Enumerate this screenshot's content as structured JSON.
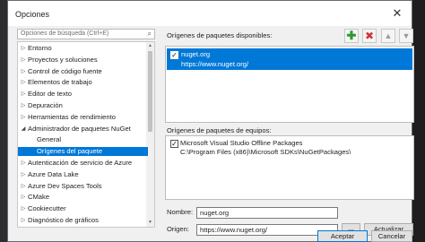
{
  "window": {
    "title": "Opciones",
    "close_glyph": "✕"
  },
  "search": {
    "placeholder": "Opciones de búsqueda (Ctrl+E)",
    "icon": "search-icon"
  },
  "tree": {
    "items": [
      {
        "label": "Entorno",
        "expanded": false,
        "depth": 0,
        "selected": false
      },
      {
        "label": "Proyectos y soluciones",
        "expanded": false,
        "depth": 0,
        "selected": false
      },
      {
        "label": "Control de código fuente",
        "expanded": false,
        "depth": 0,
        "selected": false
      },
      {
        "label": "Elementos de trabajo",
        "expanded": false,
        "depth": 0,
        "selected": false
      },
      {
        "label": "Editor de texto",
        "expanded": false,
        "depth": 0,
        "selected": false
      },
      {
        "label": "Depuración",
        "expanded": false,
        "depth": 0,
        "selected": false
      },
      {
        "label": "Herramientas de rendimiento",
        "expanded": false,
        "depth": 0,
        "selected": false
      },
      {
        "label": "Administrador de paquetes NuGet",
        "expanded": true,
        "depth": 0,
        "selected": false
      },
      {
        "label": "General",
        "expanded": null,
        "depth": 1,
        "selected": false
      },
      {
        "label": "Orígenes del paquete",
        "expanded": null,
        "depth": 1,
        "selected": true
      },
      {
        "label": "Autenticación de servicio de Azure",
        "expanded": false,
        "depth": 0,
        "selected": false
      },
      {
        "label": "Azure Data Lake",
        "expanded": false,
        "depth": 0,
        "selected": false
      },
      {
        "label": "Azure Dev Spaces Tools",
        "expanded": false,
        "depth": 0,
        "selected": false
      },
      {
        "label": "CMake",
        "expanded": false,
        "depth": 0,
        "selected": false
      },
      {
        "label": "Cookiecutter",
        "expanded": false,
        "depth": 0,
        "selected": false
      },
      {
        "label": "Diagnóstico de gráficos",
        "expanded": false,
        "depth": 0,
        "selected": false
      }
    ]
  },
  "available": {
    "label": "Orígenes de paquetes disponibles:",
    "sources": [
      {
        "name": "nuget.org",
        "url": "https://www.nuget.org/",
        "checked": true
      }
    ]
  },
  "toolbar": {
    "add_glyph": "✚",
    "remove_glyph": "✖",
    "up_glyph": "▲",
    "down_glyph": "▼"
  },
  "machine": {
    "label": "Orígenes de paquetes de equipos:",
    "sources": [
      {
        "name": "Microsoft Visual Studio Offline Packages",
        "path": "C:\\Program Files (x86)\\Microsoft SDKs\\NuGetPackages\\",
        "checked": true
      }
    ]
  },
  "form": {
    "name_label": "Nombre:",
    "name_value": "nuget.org",
    "source_label": "Origen:",
    "source_value": "https://www.nuget.org/",
    "browse_label": "...",
    "update_label": "Actualizar"
  },
  "footer": {
    "accept_label": "Aceptar",
    "cancel_label": "Cancelar"
  },
  "colors": {
    "selection": "#0078d7",
    "add": "#2e9a2e",
    "remove": "#d13438"
  }
}
